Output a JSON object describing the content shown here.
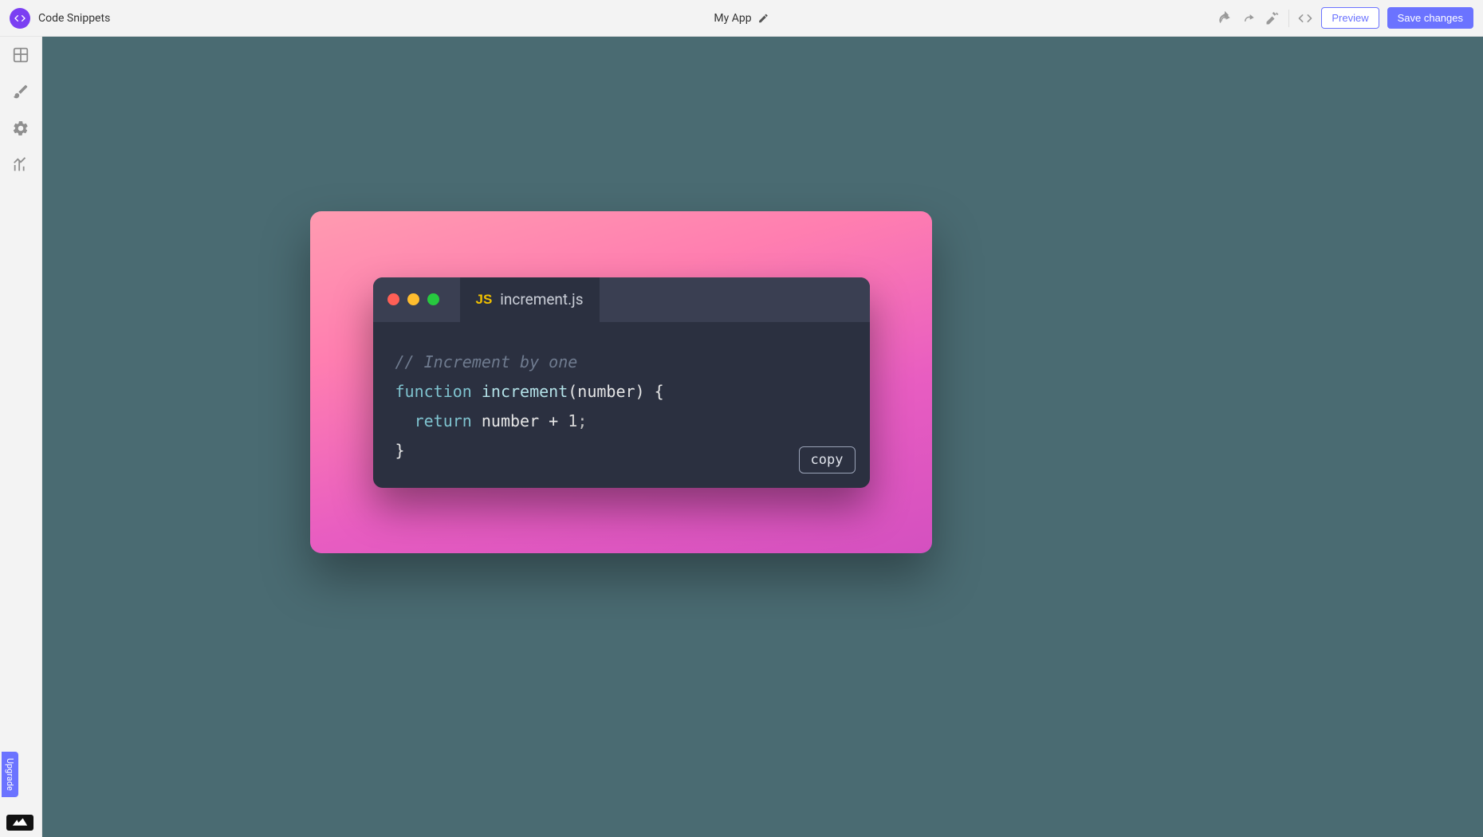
{
  "header": {
    "app_name": "Code Snippets",
    "project_title": "My App",
    "preview_label": "Preview",
    "save_label": "Save changes"
  },
  "sidebar": {
    "upgrade_label": "Upgrade"
  },
  "snippet": {
    "filename": "increment.js",
    "lang_badge": "JS",
    "copy_label": "copy",
    "code": {
      "comment": "// Increment by one",
      "kw_function": "function",
      "func_name": "increment",
      "params_open": "(number) {",
      "kw_return": "return",
      "return_expr_a": " number + ",
      "return_num": "1",
      "return_semi": ";",
      "close_brace": "}"
    }
  }
}
